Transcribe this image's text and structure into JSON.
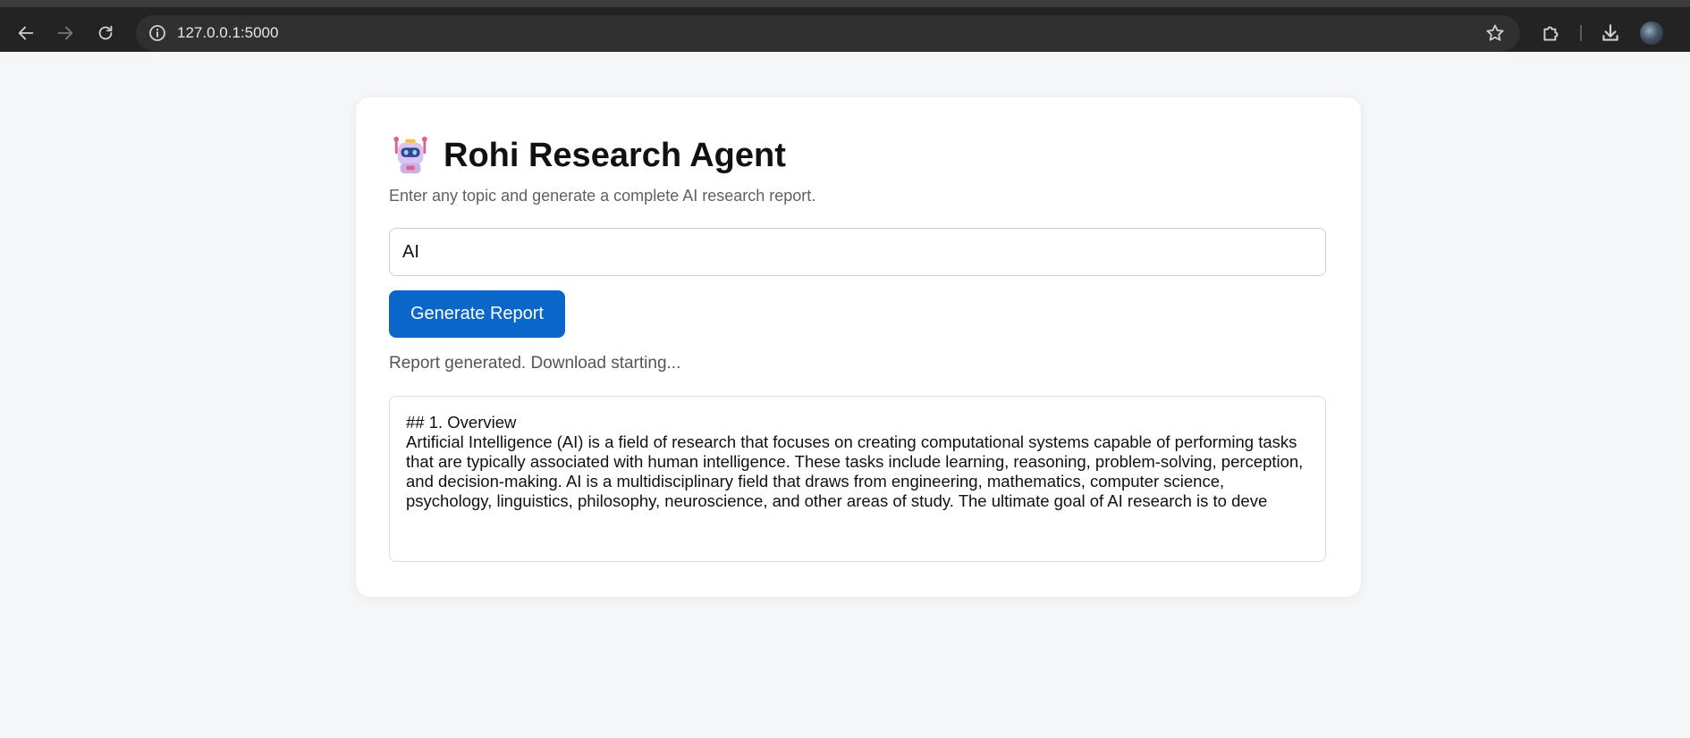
{
  "browser": {
    "url": "127.0.0.1:5000",
    "icons": {
      "back": "arrow-left-icon",
      "forward": "arrow-right-icon",
      "reload": "reload-icon",
      "site_info": "info-icon",
      "bookmark": "star-icon",
      "extensions": "puzzle-icon",
      "downloads": "download-icon",
      "profile": "avatar"
    }
  },
  "app": {
    "title": "Rohi Research Agent",
    "title_icon": "robot-icon",
    "subtitle": "Enter any topic and generate a complete AI research report.",
    "topic_input_value": "AI",
    "generate_button_label": "Generate Report",
    "status_text": "Report generated. Download starting...",
    "report_text": "## 1. Overview\nArtificial Intelligence (AI) is a field of research that focuses on creating computational systems capable of performing tasks that are typically associated with human intelligence. These tasks include learning, reasoning, problem-solving, perception, and decision-making. AI is a multidisciplinary field that draws from engineering, mathematics, computer science, psychology, linguistics, philosophy, neuroscience, and other areas of study. The ultimate goal of AI research is to deve"
  },
  "colors": {
    "primary_button": "#0a66c8",
    "page_background": "#f5f6f8",
    "card_background": "#ffffff"
  }
}
